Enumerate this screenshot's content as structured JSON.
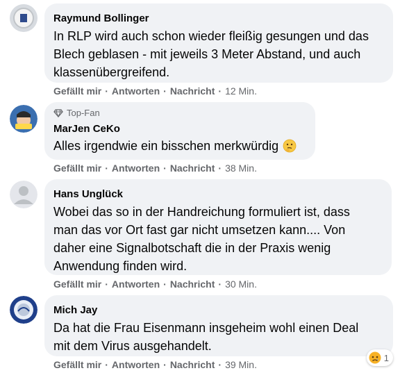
{
  "comments": [
    {
      "name": "Raymund Bollinger",
      "badge": "",
      "text": "In RLP wird auch schon wieder fleißig gesungen und das\nBlech geblasen - mit jeweils 3 Meter Abstand, und auch\nklassenübergreifend.",
      "like": "Gefällt mir",
      "reply": "Antworten",
      "message": "Nachricht",
      "time": "12 Min."
    },
    {
      "name": "MarJen CeKo",
      "badge": "Top-Fan",
      "text": "Alles irgendwie ein bisschen merkwürdig",
      "emoji": "thinking-face-icon",
      "like": "Gefällt mir",
      "reply": "Antworten",
      "message": "Nachricht",
      "time": "38 Min."
    },
    {
      "name": "Hans Unglück",
      "badge": "",
      "text": "Wobei das so in der Handreichung formuliert ist, dass\nman das vor Ort fast gar nicht umsetzen kann.... Von\ndaher eine Signalbotschaft die in der Praxis wenig\nAnwendung finden wird.",
      "like": "Gefällt mir",
      "reply": "Antworten",
      "message": "Nachricht",
      "time": "30 Min."
    },
    {
      "name": "Mich Jay",
      "badge": "",
      "text": "Da hat die Frau Eisenmann insgeheim wohl einen Deal\nmit dem Virus ausgehandelt.",
      "like": "Gefällt mir",
      "reply": "Antworten",
      "message": "Nachricht",
      "time": "39 Min.",
      "reaction_count": "1",
      "reaction_icon": "sad-face-icon"
    }
  ],
  "separator": "·",
  "colors": {
    "bubble": "#f0f2f5",
    "meta": "#65676b",
    "text": "#050505"
  }
}
